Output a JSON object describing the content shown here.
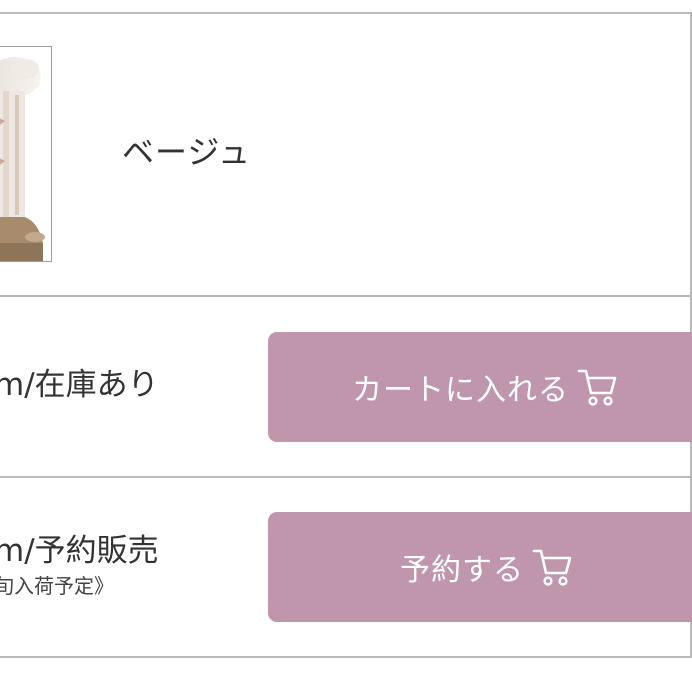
{
  "variant": {
    "color_name": "ベージュ",
    "thumbnail_icon": "product-thumbnail"
  },
  "options": [
    {
      "stock_label": "m/在庫あり",
      "sub_note": "",
      "button_label": "カートに入れる",
      "button_icon": "cart-icon"
    },
    {
      "stock_label": "m/予約販売",
      "sub_note": "旬入荷予定》",
      "button_label": "予約する",
      "button_icon": "cart-icon"
    }
  ],
  "colors": {
    "button_bg": "#c096ad",
    "button_text": "#ffffff",
    "divider": "#b9b9b9",
    "text": "#333333"
  }
}
